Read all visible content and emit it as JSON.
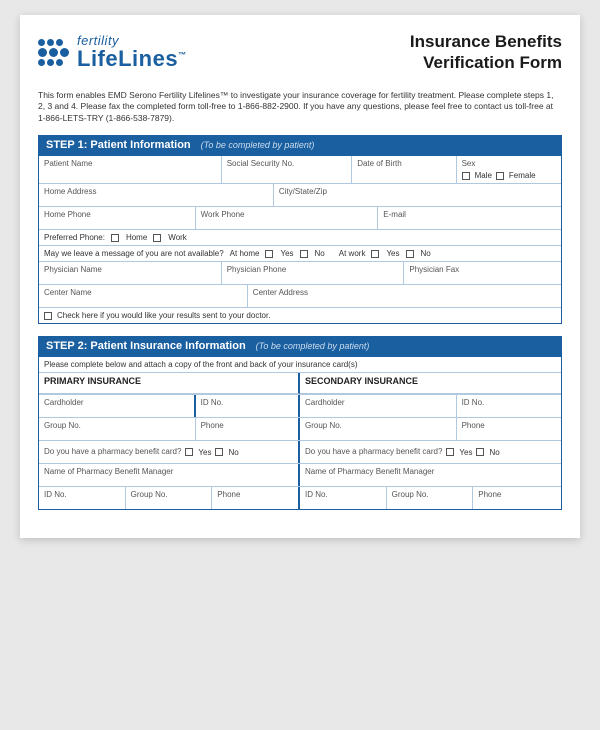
{
  "header": {
    "logo_fertility": "fertility",
    "logo_lifelines": "LifeLines",
    "logo_tm": "™",
    "form_title_line1": "Insurance Benefits",
    "form_title_line2": "Verification Form"
  },
  "intro": {
    "text": "This form enables EMD Serono Fertility Lifelines™ to investigate your insurance coverage for fertility treatment. Please complete steps 1, 2, 3 and 4. Please fax the completed form toll-free to 1-866-882-2900. If you have any questions, please feel free to contact us toll-free at 1-866-LETS-TRY (1-866-538-7879)."
  },
  "step1": {
    "title": "STEP 1: Patient Information",
    "completed_by": "(To be completed by patient)",
    "fields": {
      "patient_name": "Patient Name",
      "ssn": "Social Security No.",
      "dob": "Date of Birth",
      "sex": "Sex",
      "sex_male": "Male",
      "sex_female": "Female",
      "home_address": "Home Address",
      "city_state_zip": "City/State/Zip",
      "home_phone": "Home Phone",
      "work_phone": "Work Phone",
      "email": "E-mail",
      "preferred_phone": "Preferred Phone:",
      "pref_home": "Home",
      "pref_work": "Work",
      "leave_msg": "May we leave a message of you are not available?",
      "at_home": "At home",
      "at_home_yes": "Yes",
      "at_home_no": "No",
      "at_work": "At work",
      "at_work_yes": "Yes",
      "at_work_no": "No",
      "physician_name": "Physician Name",
      "physician_phone": "Physician Phone",
      "physician_fax": "Physician Fax",
      "center_name": "Center Name",
      "center_address": "Center Address",
      "send_results": "Check here if you would like your results sent to your doctor."
    }
  },
  "step2": {
    "title": "STEP 2: Patient Insurance Information",
    "completed_by": "(To be completed by patient)",
    "note": "Please complete below and attach a copy of the front and back of your insurance card(s)",
    "primary_header": "PRIMARY INSURANCE",
    "secondary_header": "SECONDARY INSURANCE",
    "fields": {
      "cardholder": "Cardholder",
      "id_no": "ID No.",
      "group_no": "Group No.",
      "phone": "Phone",
      "pharmacy_card": "Do you have a pharmacy benefit card?",
      "yes": "Yes",
      "no": "No",
      "pharmacy_manager": "Name of Pharmacy Benefit Manager",
      "id_no2": "ID No.",
      "group_no2": "Group No.",
      "phone2": "Phone"
    }
  }
}
